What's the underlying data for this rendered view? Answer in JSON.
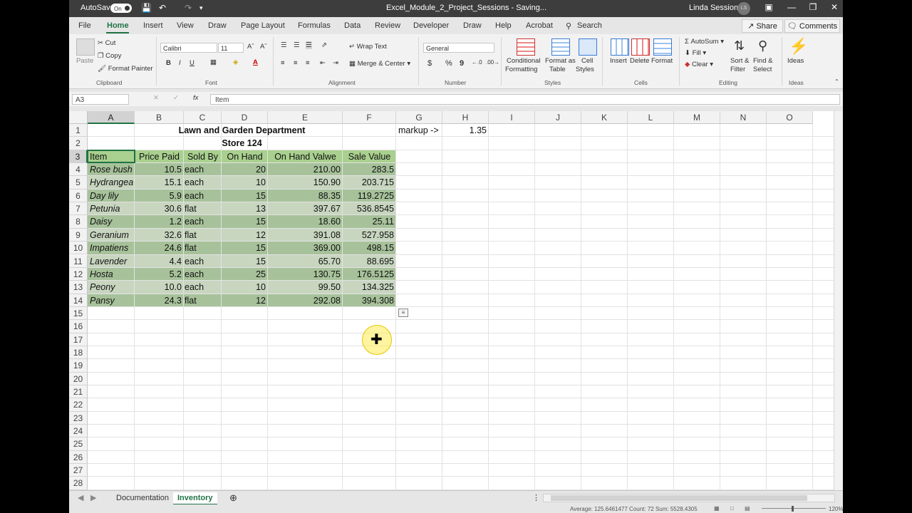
{
  "titlebar": {
    "autosave_label": "AutoSave",
    "autosave_state": "On",
    "title": "Excel_Module_2_Project_Sessions - Saving...",
    "user": "Linda Sessions",
    "initials": "LS"
  },
  "tabs": [
    "File",
    "Home",
    "Insert",
    "View",
    "Draw",
    "Page Layout",
    "Formulas",
    "Data",
    "Review",
    "Developer",
    "Draw",
    "Help",
    "Acrobat"
  ],
  "search_label": "Search",
  "share_label": "Share",
  "comments_label": "Comments",
  "ribbon": {
    "clipboard": {
      "paste": "Paste",
      "cut": "Cut",
      "copy": "Copy",
      "format_painter": "Format Painter",
      "label": "Clipboard"
    },
    "font": {
      "name": "Calibri",
      "size": "11",
      "label": "Font",
      "bold": "B",
      "italic": "I",
      "underline": "U"
    },
    "alignment": {
      "wrap": "Wrap Text",
      "merge": "Merge & Center",
      "label": "Alignment"
    },
    "number": {
      "format": "General",
      "currency": "$",
      "percent": "%",
      "comma": "9",
      "label": "Number"
    },
    "styles": {
      "cond1": "Conditional",
      "cond2": "Formatting",
      "fmt1": "Format as",
      "fmt2": "Table",
      "cell1": "Cell",
      "cell2": "Styles",
      "label": "Styles"
    },
    "cells": {
      "insert": "Insert",
      "delete": "Delete",
      "format": "Format",
      "label": "Cells"
    },
    "editing": {
      "autosum": "AutoSum",
      "fill": "Fill",
      "clear": "Clear",
      "sort1": "Sort &",
      "sort2": "Filter",
      "find1": "Find &",
      "find2": "Select",
      "label": "Editing"
    },
    "ideas": {
      "ideas": "Ideas",
      "label": "Ideas"
    }
  },
  "formula_bar": {
    "name_box": "A3",
    "fx": "fx",
    "content": "Item"
  },
  "columns": [
    "A",
    "B",
    "C",
    "D",
    "E",
    "F",
    "G",
    "H",
    "I",
    "J",
    "K",
    "L",
    "M",
    "N",
    "O"
  ],
  "rows": [
    "1",
    "2",
    "3",
    "4",
    "5",
    "6",
    "7",
    "8",
    "9",
    "10",
    "11",
    "12",
    "13",
    "14",
    "15",
    "16",
    "17",
    "18",
    "19",
    "20",
    "21",
    "22",
    "23",
    "24",
    "25",
    "26",
    "27",
    "28"
  ],
  "sheet": {
    "title": "Lawn and Garden Department",
    "subtitle": "Store 124",
    "markup_label": "markup ->",
    "markup_value": "1.35",
    "headers": [
      "Item",
      "Price Paid",
      "Sold By",
      "On Hand",
      "On Hand Valwe",
      "Sale Value"
    ],
    "data": [
      [
        "Rose bush",
        "10.5",
        "each",
        "20",
        "210.00",
        "283.5"
      ],
      [
        "Hydrangea",
        "15.1",
        "each",
        "10",
        "150.90",
        "203.715"
      ],
      [
        "Day lily",
        "5.9",
        "each",
        "15",
        "88.35",
        "119.2725"
      ],
      [
        "Petunia",
        "30.6",
        "flat",
        "13",
        "397.67",
        "536.8545"
      ],
      [
        "Daisy",
        "1.2",
        "each",
        "15",
        "18.60",
        "25.11"
      ],
      [
        "Geranium",
        "32.6",
        "flat",
        "12",
        "391.08",
        "527.958"
      ],
      [
        "Impatiens",
        "24.6",
        "flat",
        "15",
        "369.00",
        "498.15"
      ],
      [
        "Lavender",
        "4.4",
        "each",
        "15",
        "65.70",
        "88.695"
      ],
      [
        "Hosta",
        "5.2",
        "each",
        "25",
        "130.75",
        "176.5125"
      ],
      [
        "Peony",
        "10.0",
        "each",
        "10",
        "99.50",
        "134.325"
      ],
      [
        "Pansy",
        "24.3",
        "flat",
        "12",
        "292.08",
        "394.308"
      ]
    ]
  },
  "sheet_tabs": [
    "Documentation",
    "Inventory"
  ],
  "status": "Average: 125.6461477   Count: 72   Sum: 5528.4305",
  "zoom": "120%"
}
